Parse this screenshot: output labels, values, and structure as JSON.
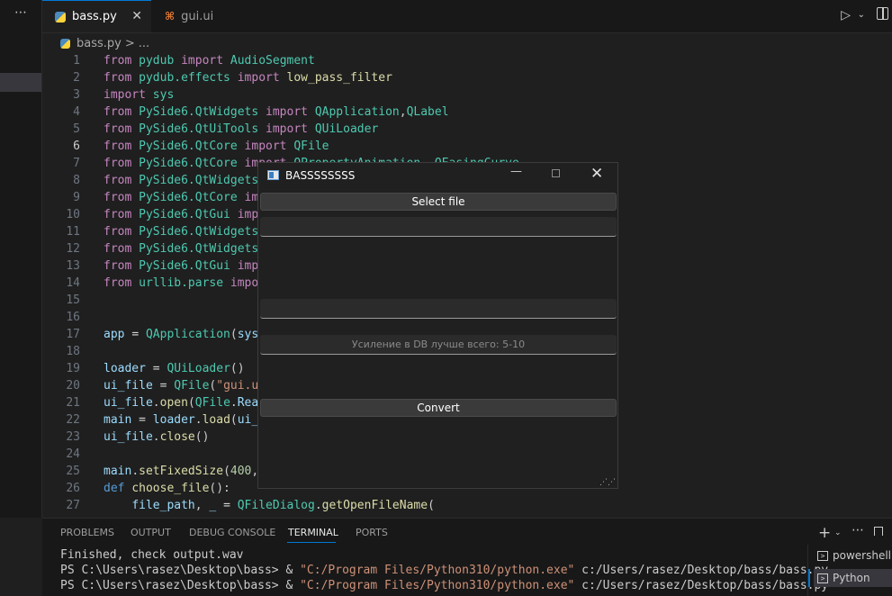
{
  "sidebar": {
    "more_icon": "⋯"
  },
  "tabs": [
    {
      "label": "bass.py",
      "icon": "python-file-icon",
      "active": true,
      "close": "✕"
    },
    {
      "label": "gui.ui",
      "icon": "rss-file-icon",
      "active": false
    }
  ],
  "toolbar": {
    "run_icon": "▷",
    "chevron": "⌵",
    "split_icon": "split-editor-icon"
  },
  "breadcrumb": {
    "file": "bass.py",
    "sep": ">",
    "more": "..."
  },
  "editor": {
    "active_line": 6,
    "line_numbers": [
      "1",
      "2",
      "3",
      "4",
      "5",
      "6",
      "7",
      "8",
      "9",
      "10",
      "11",
      "12",
      "13",
      "14",
      "15",
      "16",
      "17",
      "18",
      "19",
      "20",
      "21",
      "22",
      "23",
      "24",
      "25",
      "26",
      "27"
    ]
  },
  "qt_window": {
    "title": "BASSSSSSSS",
    "select_button": "Select file",
    "gain_placeholder": "Усиление в DB лучше всего: 5-10",
    "convert_button": "Convert",
    "minimize": "—",
    "close": "✕"
  },
  "panel": {
    "tabs": [
      "PROBLEMS",
      "OUTPUT",
      "DEBUG CONSOLE",
      "TERMINAL",
      "PORTS"
    ],
    "active_tab": "TERMINAL",
    "plus": "+",
    "chevron": "⌵",
    "more": "⋯",
    "terminal_lines": [
      {
        "text": "Finished, check output.wav"
      },
      {
        "prompt": "PS C:\\Users\\rasez\\Desktop\\bass> & ",
        "string": "\"C:/Program Files/Python310/python.exe\"",
        "rest": " c:/Users/rasez/Desktop/bass/bass.py"
      },
      {
        "prompt": "PS C:\\Users\\rasez\\Desktop\\bass> & ",
        "string": "\"C:/Program Files/Python310/python.exe\"",
        "rest": " c:/Users/rasez/Desktop/bass/bass.py"
      }
    ],
    "terminals": [
      "powershell",
      "Python"
    ]
  },
  "colors": {
    "accent": "#0078d4",
    "keyword": "#c586c0",
    "module": "#4ec9b0",
    "function": "#dcdcaa",
    "variable": "#9cdcfe",
    "string": "#ce9178"
  }
}
